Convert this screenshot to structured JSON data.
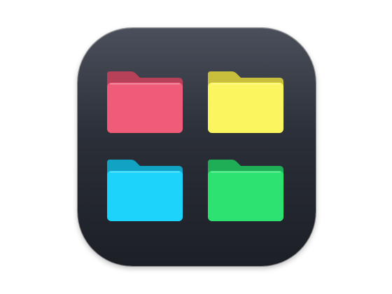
{
  "app_icon": {
    "name": "folder-grid-app-icon"
  },
  "folders": [
    {
      "name": "red-folder-icon",
      "front": "#ef5b78",
      "back": "#b8415a"
    },
    {
      "name": "yellow-folder-icon",
      "front": "#fbf55f",
      "back": "#c9bf3c"
    },
    {
      "name": "blue-folder-icon",
      "front": "#1bd3fb",
      "back": "#12a2c4"
    },
    {
      "name": "green-folder-icon",
      "front": "#2ee272",
      "back": "#1fae55"
    }
  ]
}
